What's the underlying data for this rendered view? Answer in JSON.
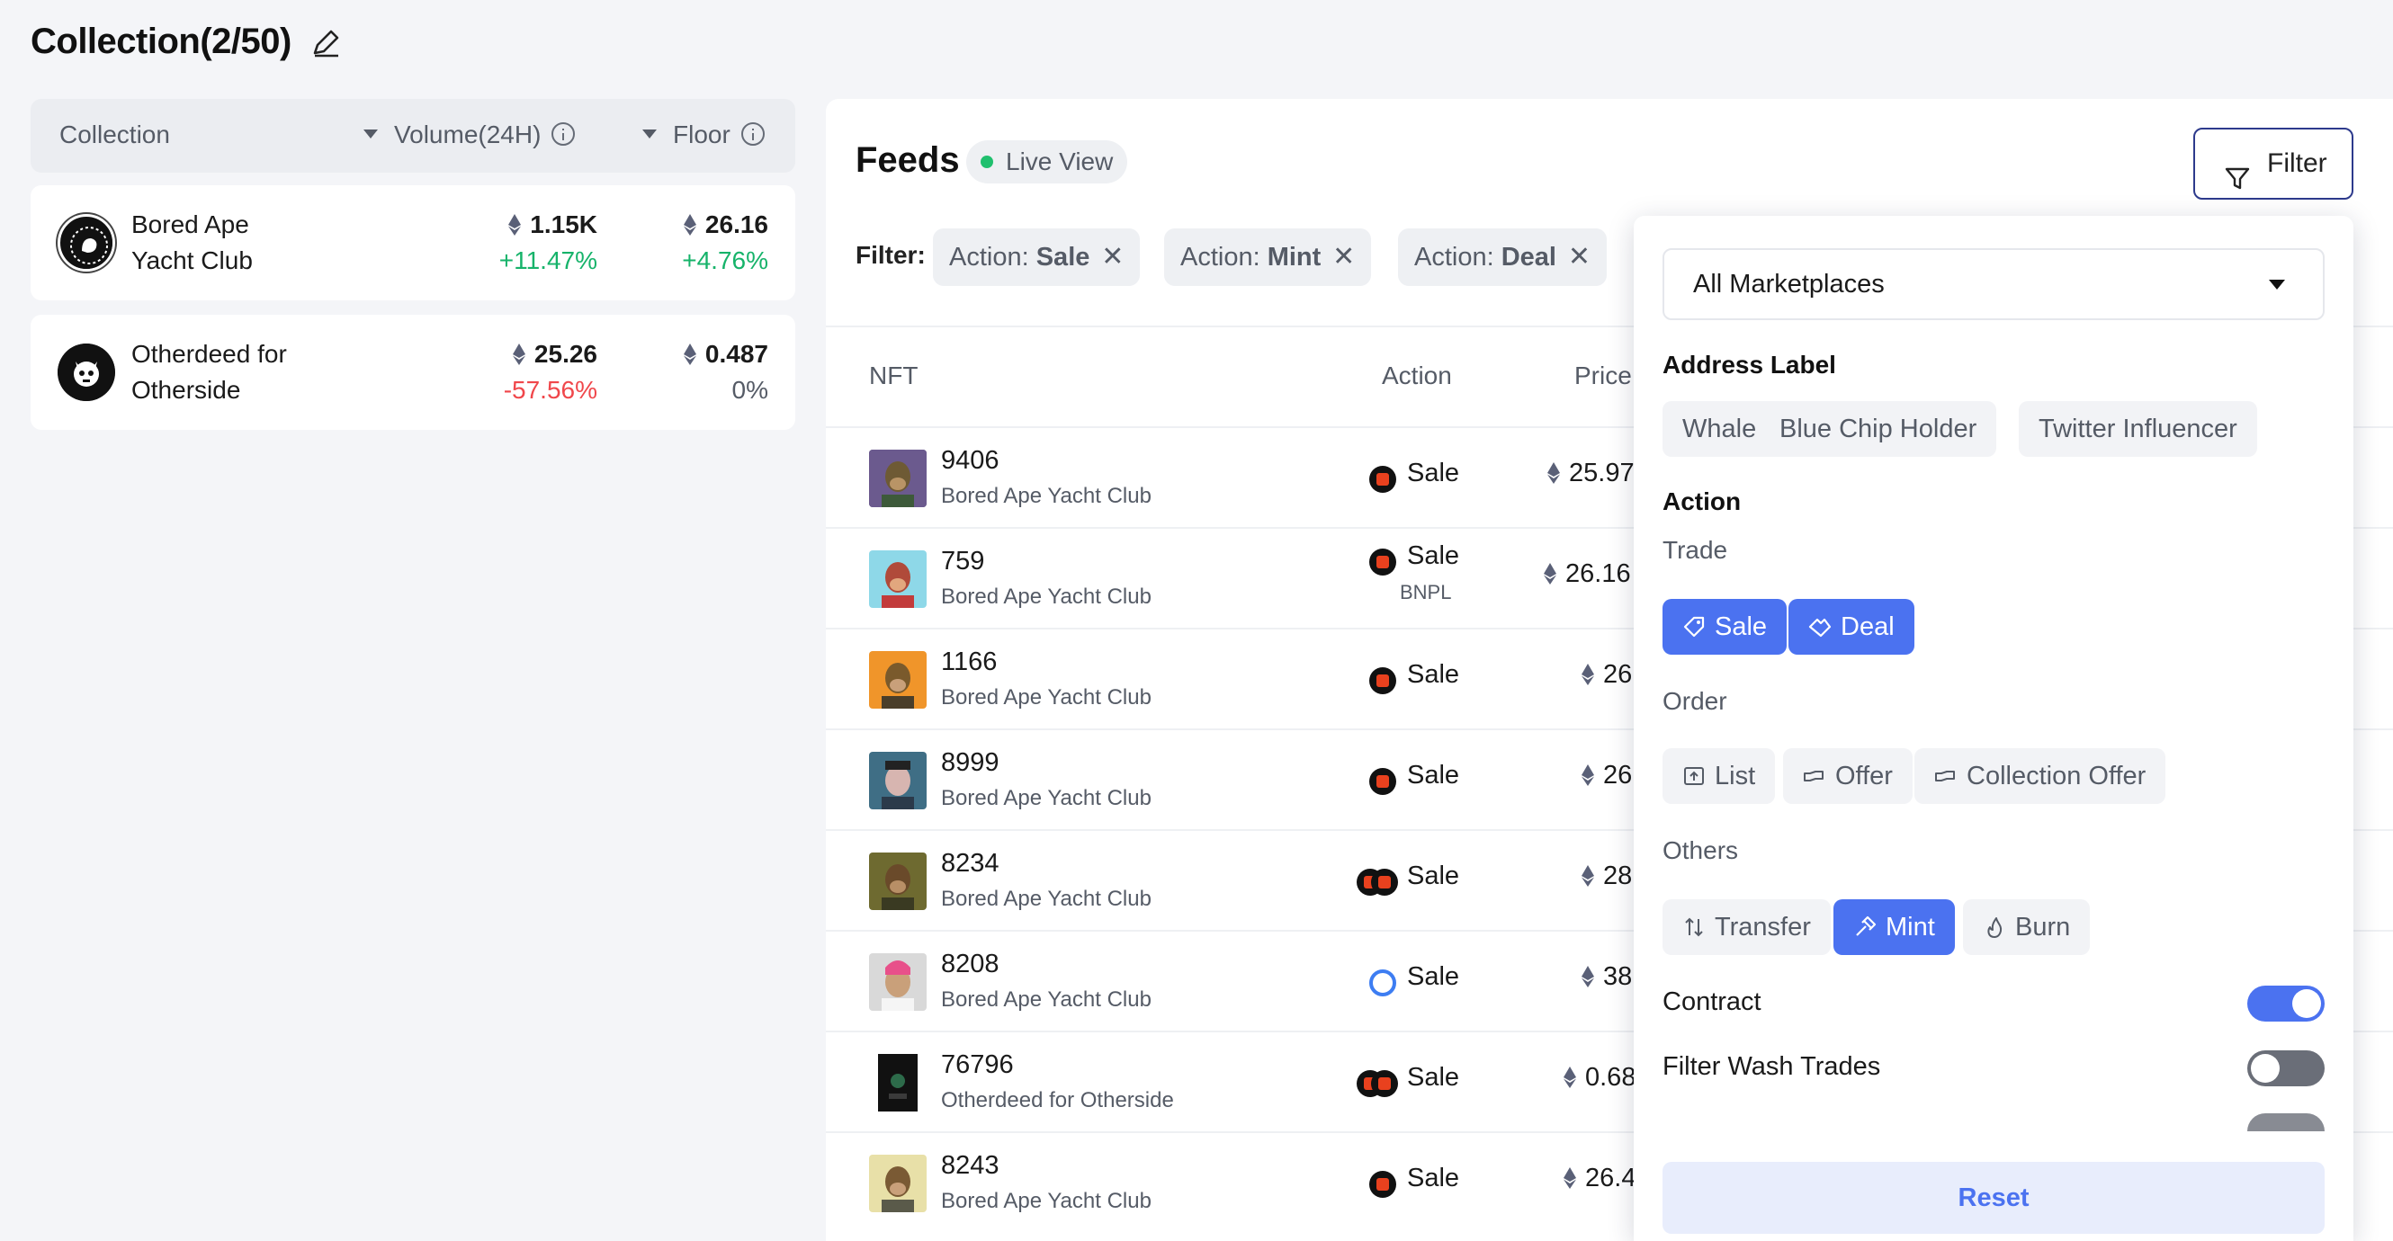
{
  "header": {
    "title": "Collection(2/50)"
  },
  "collections": {
    "columns": {
      "collection": "Collection",
      "volume": "Volume(24H)",
      "floor": "Floor"
    },
    "items": [
      {
        "name_line1": "Bored Ape",
        "name_line2": "Yacht Club",
        "volume": "1.15K",
        "volume_change": "+11.47%",
        "floor": "26.16",
        "floor_change": "+4.76%"
      },
      {
        "name_line1": "Otherdeed for",
        "name_line2": "Otherside",
        "volume": "25.26",
        "volume_change": "-57.56%",
        "floor": "0.487",
        "floor_change": "0%"
      }
    ]
  },
  "feeds": {
    "title": "Feeds",
    "live_label": "Live View",
    "filter_button": "Filter",
    "filter_label": "Filter:",
    "chips": [
      {
        "prefix": "Action: ",
        "value": "Sale"
      },
      {
        "prefix": "Action: ",
        "value": "Mint"
      },
      {
        "prefix": "Action: ",
        "value": "Deal"
      }
    ],
    "columns": {
      "nft": "NFT",
      "action": "Action",
      "price": "Price"
    },
    "rows": [
      {
        "id": "9406",
        "collection": "Bored Ape Yacht Club",
        "action": "Sale",
        "sub": "",
        "price": "25.97"
      },
      {
        "id": "759",
        "collection": "Bored Ape Yacht Club",
        "action": "Sale",
        "sub": "BNPL",
        "price": "26.16"
      },
      {
        "id": "1166",
        "collection": "Bored Ape Yacht Club",
        "action": "Sale",
        "sub": "",
        "price": "26"
      },
      {
        "id": "8999",
        "collection": "Bored Ape Yacht Club",
        "action": "Sale",
        "sub": "",
        "price": "26"
      },
      {
        "id": "8234",
        "collection": "Bored Ape Yacht Club",
        "action": "Sale",
        "sub": "",
        "price": "28"
      },
      {
        "id": "8208",
        "collection": "Bored Ape Yacht Club",
        "action": "Sale",
        "sub": "",
        "price": "38"
      },
      {
        "id": "76796",
        "collection": "Otherdeed for Otherside",
        "action": "Sale",
        "sub": "",
        "price": "0.68"
      },
      {
        "id": "8243",
        "collection": "Bored Ape Yacht Club",
        "action": "Sale",
        "sub": "",
        "price": "26.4"
      }
    ]
  },
  "filter_panel": {
    "marketplace": "All Marketplaces",
    "address_label_title": "Address Label",
    "address_labels": [
      "Whale",
      "Blue Chip Holder",
      "Twitter Influencer"
    ],
    "action_title": "Action",
    "trade_title": "Trade",
    "trade": [
      "Sale",
      "Deal"
    ],
    "order_title": "Order",
    "order": [
      "List",
      "Offer",
      "Collection Offer"
    ],
    "others_title": "Others",
    "others": [
      "Transfer",
      "Mint",
      "Burn"
    ],
    "contract_label": "Contract",
    "wash_label": "Filter Wash Trades",
    "reset": "Reset"
  },
  "colors": {
    "accent": "#4b72f0",
    "positive": "#16b36a",
    "negative": "#f0474b",
    "live": "#20c06e"
  }
}
